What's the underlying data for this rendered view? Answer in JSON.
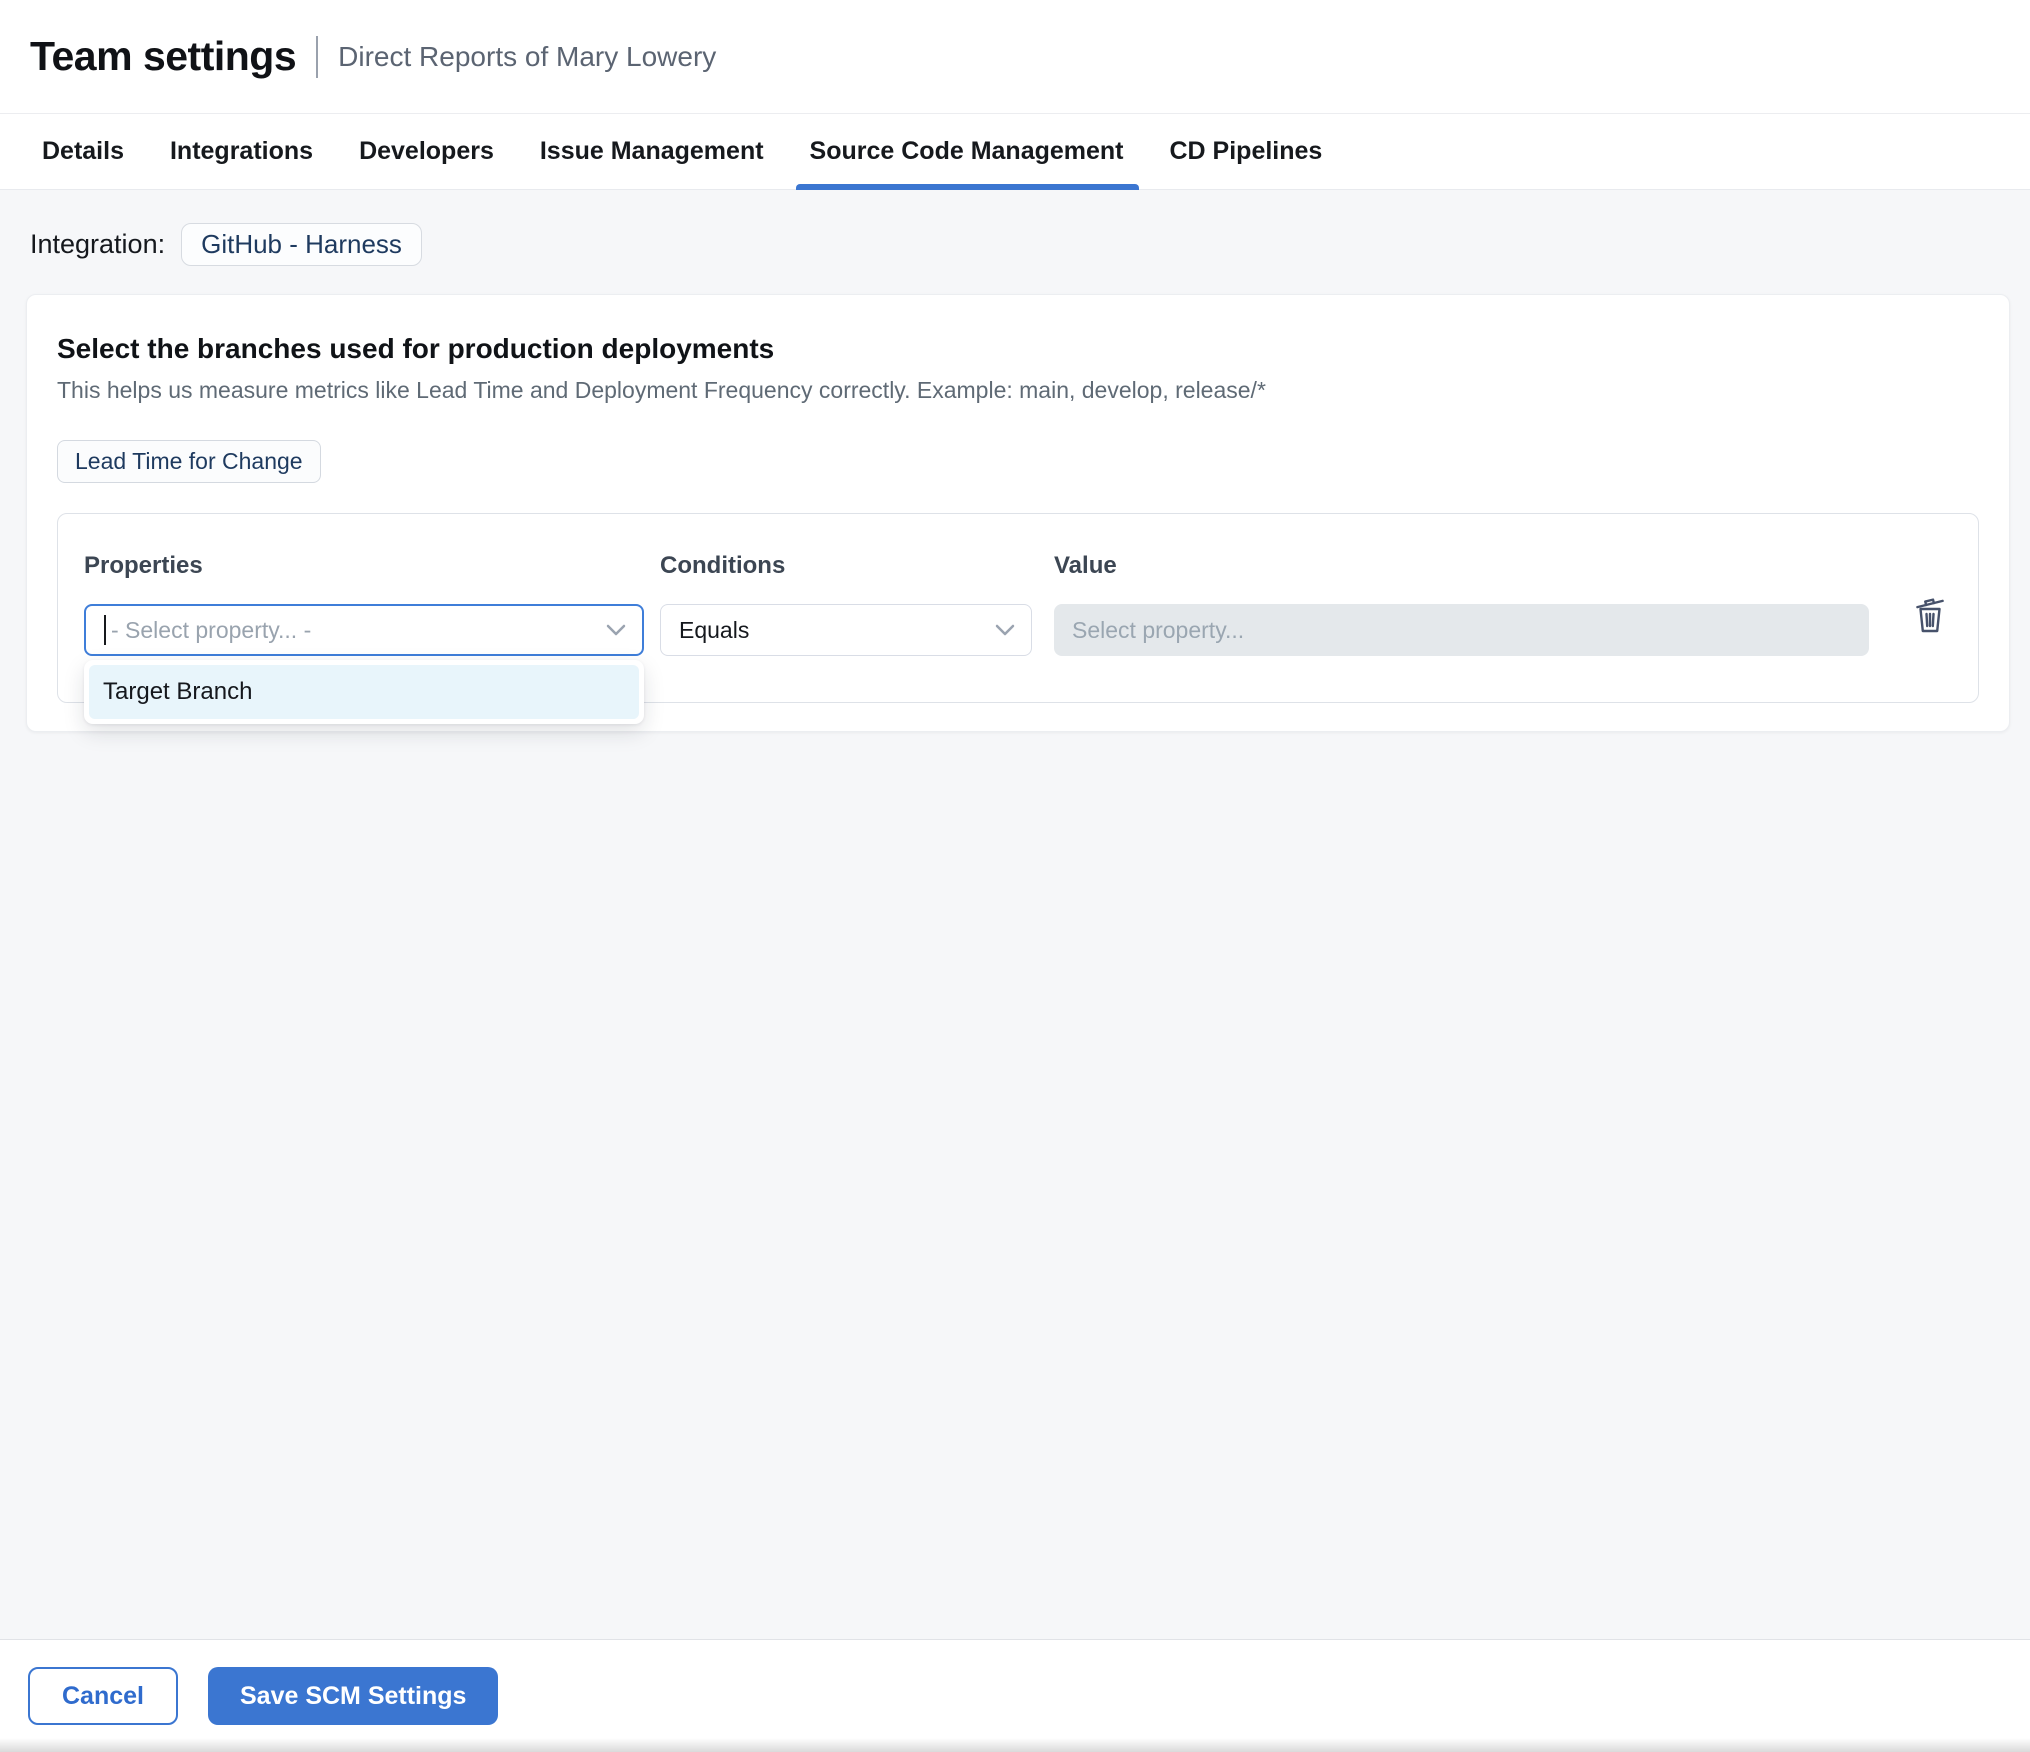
{
  "header": {
    "title": "Team settings",
    "subtitle": "Direct Reports of Mary Lowery"
  },
  "tabs": [
    {
      "label": "Details",
      "active": false
    },
    {
      "label": "Integrations",
      "active": false
    },
    {
      "label": "Developers",
      "active": false
    },
    {
      "label": "Issue Management",
      "active": false
    },
    {
      "label": "Source Code Management",
      "active": true
    },
    {
      "label": "CD Pipelines",
      "active": false
    }
  ],
  "integration": {
    "label": "Integration:",
    "value": "GitHub - Harness"
  },
  "scm_card": {
    "title": "Select the branches used for production deployments",
    "description": "This helps us measure metrics like Lead Time and Deployment Frequency correctly. Example: main, develop, release/*",
    "metric_badge": "Lead Time for Change"
  },
  "rule_builder": {
    "columns": {
      "properties": "Properties",
      "conditions": "Conditions",
      "value": "Value"
    },
    "property_select": {
      "placeholder": "- Select property... -"
    },
    "condition_select": {
      "value": "Equals"
    },
    "value_input": {
      "placeholder": "Select property..."
    },
    "dropdown_options": [
      "Target Branch"
    ]
  },
  "footer": {
    "cancel_label": "Cancel",
    "save_label": "Save SCM Settings"
  },
  "icons": {
    "property_select": "chevron-down",
    "condition_select": "chevron-down",
    "delete_rule": "trash"
  },
  "colors": {
    "accent_blue": "#3B76D1",
    "focus_border": "#3F7ED9",
    "navy": "#1E3A5F",
    "page_bg": "#F6F7F9",
    "dropdown_item_bg": "#E8F5FB",
    "disabled_input_bg": "#E4E8EB"
  }
}
